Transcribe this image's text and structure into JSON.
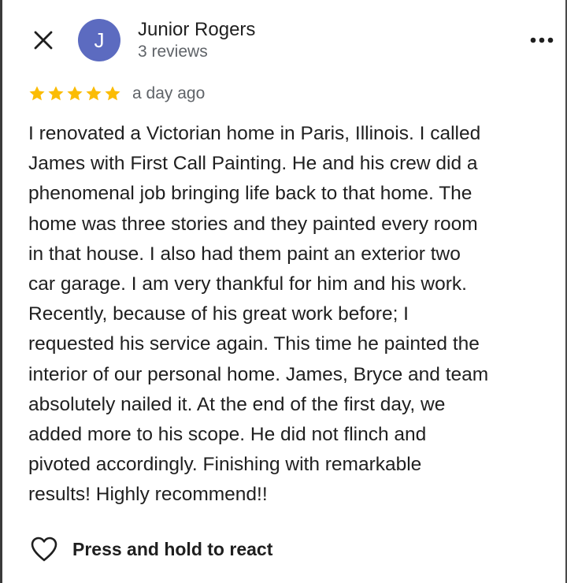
{
  "reviewer": {
    "name": "Junior Rogers",
    "avatar_initial": "J",
    "avatar_color": "#5c6bc0",
    "review_count": "3 reviews"
  },
  "review": {
    "rating": 5,
    "max_rating": 5,
    "star_color": "#fbbc04",
    "time": "a day ago",
    "lines": [
      "I renovated a Victorian home in Paris, Illinois. I called",
      "James with First Call Painting. He and his crew did a",
      "phenomenal job bringing life back to that home. The",
      "home was three stories and they painted every room",
      "in that house. I also had them paint an exterior two",
      "car garage.  I am very thankful for him and his work.",
      "Recently, because of his great work before; I",
      "requested his service again. This time he painted the",
      "interior of our personal home. James, Bryce and team",
      "absolutely nailed it. At the end of the first day, we",
      "added more to his scope. He did not flinch and",
      "pivoted accordingly. Finishing with remarkable",
      "results!  Highly recommend!!"
    ]
  },
  "actions": {
    "react_label": "Press and hold to react",
    "close_icon": "close-icon",
    "more_icon": "more-vert-icon",
    "react_icon": "heart-outline-icon"
  }
}
